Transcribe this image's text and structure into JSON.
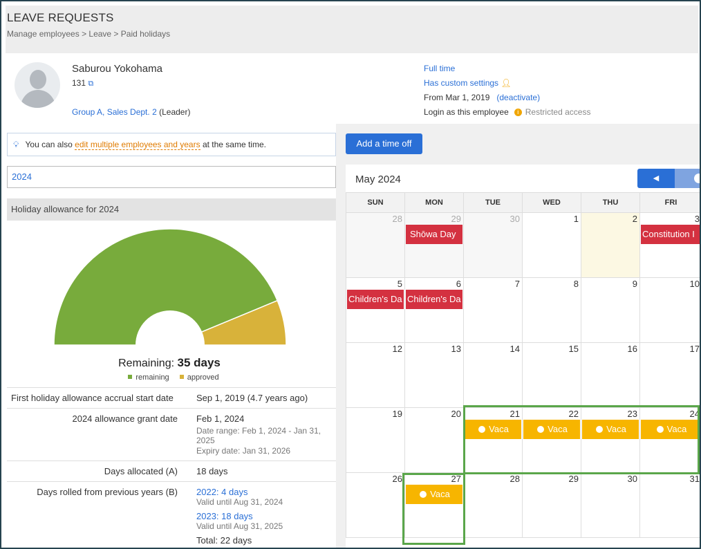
{
  "header": {
    "title": "LEAVE REQUESTS",
    "breadcrumb": "Manage employees > Leave > Paid holidays"
  },
  "employee": {
    "name": "Saburou Yokohama",
    "id": "131",
    "group_link": "Group A, Sales Dept. 2",
    "group_role": "(Leader)",
    "employment_type": "Full time",
    "custom_settings": "Has custom settings",
    "from_date": "From Mar 1, 2019",
    "deactivate": "(deactivate)",
    "login_as": "Login as this employee",
    "restricted": "Restricted access"
  },
  "tip": {
    "prefix": "You can also",
    "link": "edit multiple employees and years",
    "suffix": "at the same time."
  },
  "year_select": "2024",
  "allowance": {
    "title": "Holiday allowance for 2024",
    "remaining_label": "Remaining:",
    "remaining_value": "35 days",
    "legend_remaining": "remaining",
    "legend_approved": "approved",
    "rows": [
      {
        "label": "First holiday allowance accrual start date",
        "value": "Sep 1, 2019 (4.7 years ago)"
      },
      {
        "label": "2024 allowance grant date",
        "value": "Feb 1, 2024",
        "sub1": "Date range: Feb 1, 2024 - Jan 31, 2025",
        "sub2": "Expiry date: Jan 31, 2026"
      },
      {
        "label": "Days allocated (A)",
        "value": "18 days"
      },
      {
        "label": "Days rolled from previous years (B)",
        "v1": "2022: 4 days",
        "v1sub": "Valid until Aug 31, 2024",
        "v2": "2023: 18 days",
        "v2sub": "Valid until Aug 31, 2025",
        "total": "Total: 22 days"
      }
    ]
  },
  "colors": {
    "accent": "#2a6fd6",
    "remaining": "#78ab3c",
    "approved": "#d8b23a",
    "holiday": "#d43140",
    "vacation": "#f7b500",
    "highlight": "#5aa64a"
  },
  "chart_data": {
    "type": "pie",
    "categories": [
      "remaining",
      "approved"
    ],
    "values": [
      35,
      5
    ]
  },
  "calendar": {
    "add_button": "Add a time off",
    "month_title": "May 2024",
    "days": [
      "SUN",
      "MON",
      "TUE",
      "WED",
      "THU",
      "FRI"
    ],
    "weeks": [
      [
        "28",
        "29",
        "30",
        "1",
        "2",
        "3"
      ],
      [
        "5",
        "6",
        "7",
        "8",
        "9",
        "10"
      ],
      [
        "12",
        "13",
        "14",
        "15",
        "16",
        "17"
      ],
      [
        "19",
        "20",
        "21",
        "22",
        "23",
        "24"
      ],
      [
        "26",
        "27",
        "28",
        "29",
        "30",
        "31"
      ]
    ],
    "holidays": {
      "showa": "Shōwa Day",
      "constitution": "Constitution I",
      "children": "Children's Da"
    },
    "vacation_label": "Vaca"
  }
}
